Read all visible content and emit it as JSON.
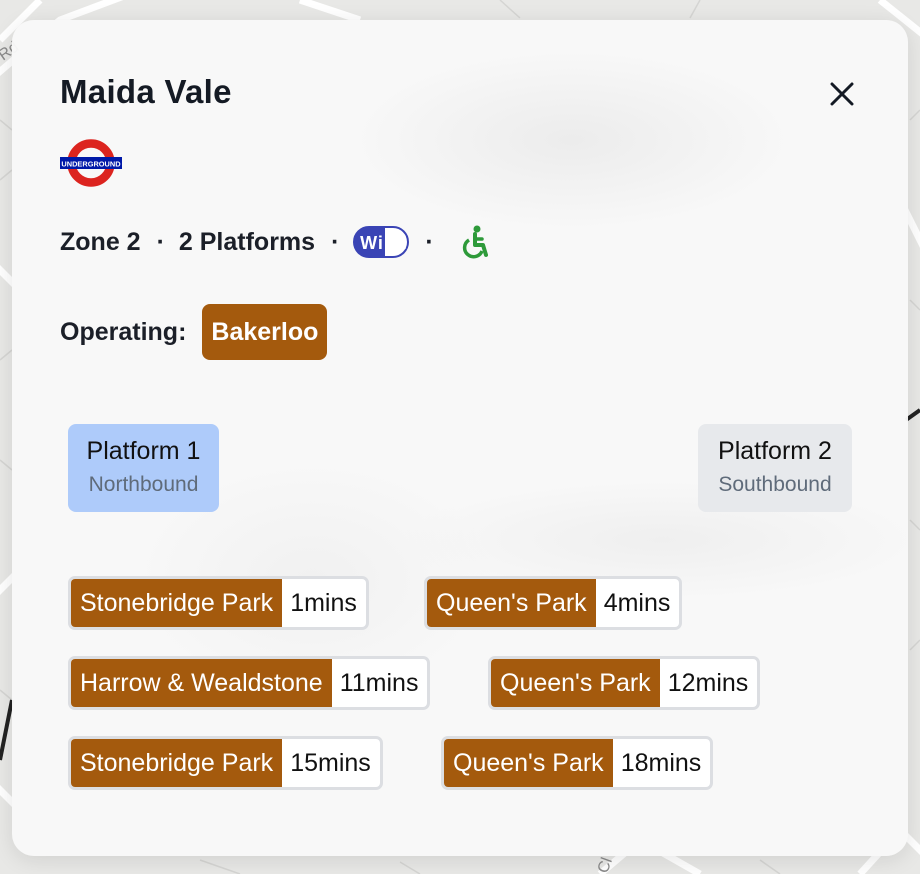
{
  "station": {
    "name": "Maida Vale",
    "roundel_text": "UNDERGROUND",
    "zone": "Zone 2",
    "platforms_count": "2 Platforms",
    "separator": "·",
    "wifi_icon": "wifi-icon",
    "wifi_text": "Wi Fi",
    "accessibility_icon": "wheelchair-icon"
  },
  "operating": {
    "label": "Operating:",
    "lines": [
      {
        "name": "Bakerloo",
        "color": "#a45a0d"
      }
    ]
  },
  "platforms": [
    {
      "name": "Platform 1",
      "direction": "Northbound",
      "selected": true
    },
    {
      "name": "Platform 2",
      "direction": "Southbound",
      "selected": false
    }
  ],
  "departures": [
    {
      "destination": "Stonebridge Park",
      "time": "1mins"
    },
    {
      "destination": "Queen's Park",
      "time": "4mins"
    },
    {
      "destination": "Harrow & Wealdstone",
      "time": "11mins"
    },
    {
      "destination": "Queen's Park",
      "time": "12mins"
    },
    {
      "destination": "Stonebridge Park",
      "time": "15mins"
    },
    {
      "destination": "Queen's Park",
      "time": "18mins"
    }
  ],
  "colors": {
    "bakerloo": "#a45a0d",
    "platform_selected": "#aecbfa",
    "platform_unselected": "#e7e9ec",
    "roundel_red": "#dc241f",
    "roundel_blue": "#0019a8",
    "wifi_blue": "#3a44b5",
    "accessible_green": "#2e9a3a"
  },
  "map": {
    "street_label_top": "Rd",
    "street_label_bottom": "Cl"
  }
}
